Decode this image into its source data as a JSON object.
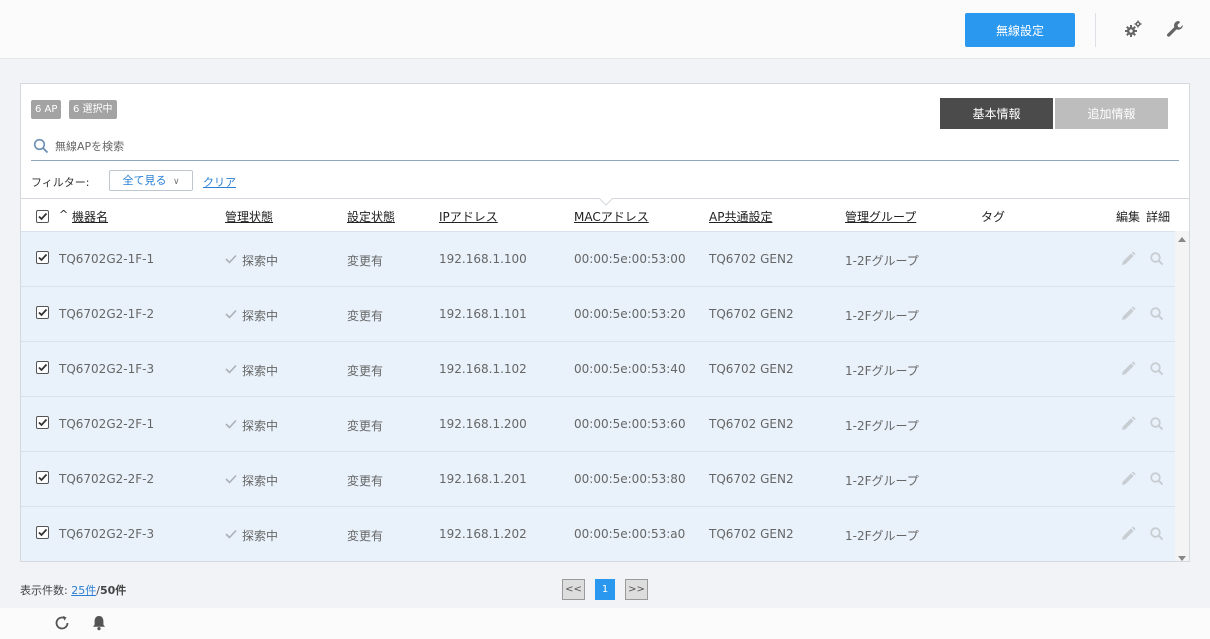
{
  "header": {
    "wireless_button": "無線設定",
    "icons": [
      "gears-icon",
      "wrench-icon"
    ]
  },
  "panel": {
    "badges": [
      "6 AP",
      "6 選択中"
    ],
    "tabs": [
      "基本情報",
      "追加情報"
    ],
    "active_tab": "基本情報",
    "search": {
      "placeholder": "無線APを検索",
      "value": ""
    },
    "filter": {
      "label": "フィルター:",
      "selected": "全て見る",
      "clear": "クリア"
    },
    "columns": {
      "sort_indicator": "^",
      "device_name": "機器名",
      "mgmt_status": "管理状態",
      "config_status": "設定状態",
      "ip": "IPアドレス",
      "mac": "MACアドレス",
      "ap_common": "AP共通設定",
      "mgmt_group": "管理グループ",
      "tag": "タグ",
      "edit": "編集",
      "detail": "詳細"
    },
    "rows": [
      {
        "checked": true,
        "name": "TQ6702G2-1F-1",
        "mgmt_status": "探索中",
        "config_status": "変更有",
        "ip": "192.168.1.100",
        "mac": "00:00:5e:00:53:00",
        "ap_common": "TQ6702 GEN2",
        "group": "1-2Fグループ",
        "tag": ""
      },
      {
        "checked": true,
        "name": "TQ6702G2-1F-2",
        "mgmt_status": "探索中",
        "config_status": "変更有",
        "ip": "192.168.1.101",
        "mac": "00:00:5e:00:53:20",
        "ap_common": "TQ6702 GEN2",
        "group": "1-2Fグループ",
        "tag": ""
      },
      {
        "checked": true,
        "name": "TQ6702G2-1F-3",
        "mgmt_status": "探索中",
        "config_status": "変更有",
        "ip": "192.168.1.102",
        "mac": "00:00:5e:00:53:40",
        "ap_common": "TQ6702 GEN2",
        "group": "1-2Fグループ",
        "tag": ""
      },
      {
        "checked": true,
        "name": "TQ6702G2-2F-1",
        "mgmt_status": "探索中",
        "config_status": "変更有",
        "ip": "192.168.1.200",
        "mac": "00:00:5e:00:53:60",
        "ap_common": "TQ6702 GEN2",
        "group": "1-2Fグループ",
        "tag": ""
      },
      {
        "checked": true,
        "name": "TQ6702G2-2F-2",
        "mgmt_status": "探索中",
        "config_status": "変更有",
        "ip": "192.168.1.201",
        "mac": "00:00:5e:00:53:80",
        "ap_common": "TQ6702 GEN2",
        "group": "1-2Fグループ",
        "tag": ""
      },
      {
        "checked": true,
        "name": "TQ6702G2-2F-3",
        "mgmt_status": "探索中",
        "config_status": "変更有",
        "ip": "192.168.1.202",
        "mac": "00:00:5e:00:53:a0",
        "ap_common": "TQ6702 GEN2",
        "group": "1-2Fグループ",
        "tag": ""
      }
    ]
  },
  "footer": {
    "count_label": "表示件数:",
    "per_page": "25件",
    "separator": "/",
    "total": "50件",
    "pager_prev": "<<",
    "pager_current": "1",
    "pager_next": ">>"
  },
  "colors": {
    "accent": "#2a98ee",
    "row_bg": "#e9f2fb",
    "tab_active": "#4b4b4b",
    "tab_inactive": "#bdbdbd",
    "badge": "#a3a3a3"
  }
}
